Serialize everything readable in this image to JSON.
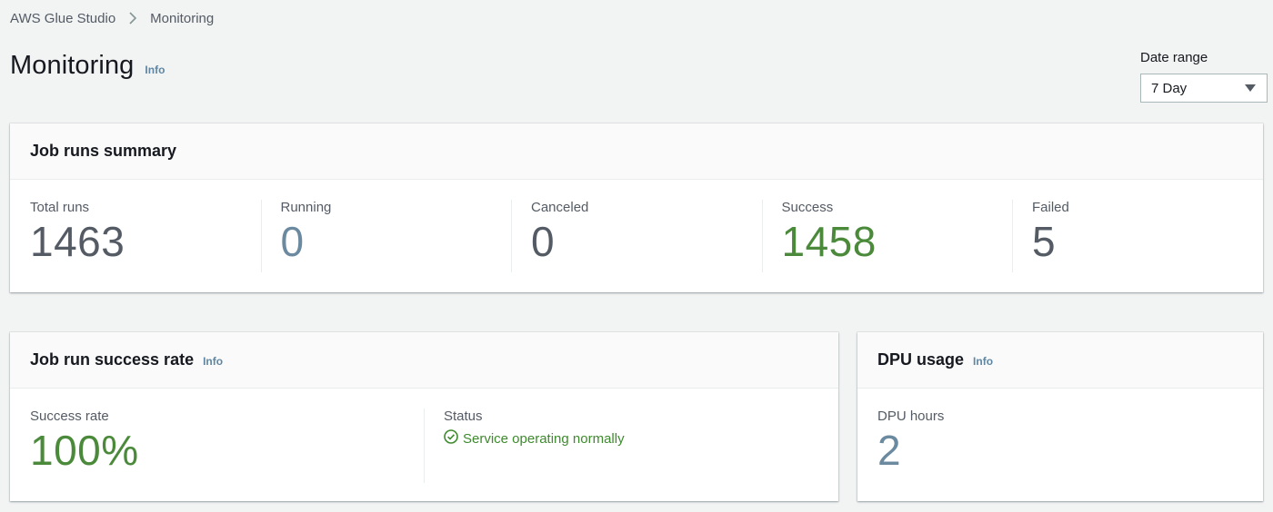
{
  "breadcrumb": {
    "root": "AWS Glue Studio",
    "current": "Monitoring"
  },
  "page": {
    "title": "Monitoring",
    "info": "Info"
  },
  "date_range": {
    "label": "Date range",
    "selected": "7 Day"
  },
  "summary": {
    "title": "Job runs summary",
    "metrics": [
      {
        "label": "Total runs",
        "value": "1463"
      },
      {
        "label": "Running",
        "value": "0"
      },
      {
        "label": "Canceled",
        "value": "0"
      },
      {
        "label": "Success",
        "value": "1458"
      },
      {
        "label": "Failed",
        "value": "5"
      }
    ]
  },
  "success_rate": {
    "title": "Job run success rate",
    "info": "Info",
    "rate_label": "Success rate",
    "rate_value": "100%",
    "status_label": "Status",
    "status_text": "Service operating normally",
    "status_icon": "check-circle-icon"
  },
  "dpu": {
    "title": "DPU usage",
    "info": "Info",
    "hours_label": "DPU hours",
    "hours_value": "2"
  },
  "colors": {
    "background": "#f2f3f3",
    "success_green": "#4b8a3b",
    "status_green": "#3d8b2c",
    "info_link": "#5f86a3",
    "muted_blue": "#6b8aa0",
    "text_gray": "#545b64"
  }
}
